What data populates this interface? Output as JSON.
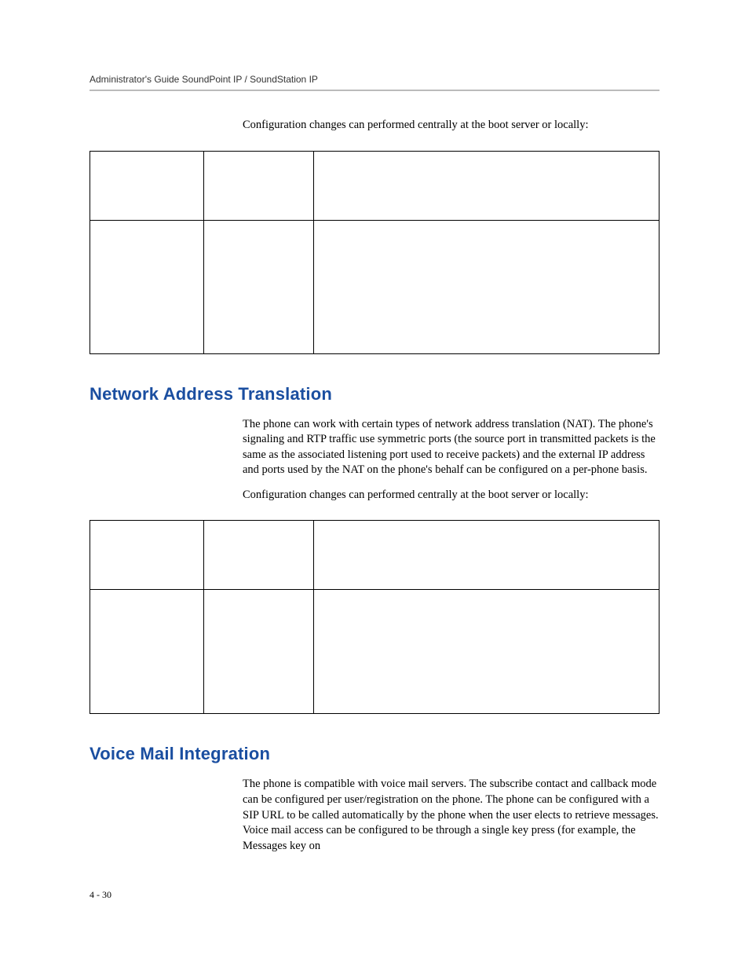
{
  "header": {
    "running": "Administrator's Guide SoundPoint IP / SoundStation IP"
  },
  "section1": {
    "intro": "Configuration changes can performed centrally at the boot server or locally:"
  },
  "section2": {
    "heading": "Network Address Translation",
    "para1": "The phone can work with certain types of network address translation (NAT). The phone's signaling and RTP traffic use symmetric ports (the source port in transmitted packets is the same as the associated listening port used to receive packets) and the external IP address and ports used by the NAT on the phone's behalf can be configured on a per-phone basis.",
    "para2": "Configuration changes can performed centrally at the boot server or locally:"
  },
  "section3": {
    "heading": "Voice Mail Integration",
    "para1": "The phone is compatible with voice mail servers. The subscribe contact and callback mode can be configured per user/registration on the phone. The phone can be configured with a SIP URL to be called automatically by the phone when the user elects to retrieve messages. Voice mail access can be configured to be through a single key press (for example, the Messages key on"
  },
  "footer": {
    "pagenum": "4 - 30"
  }
}
